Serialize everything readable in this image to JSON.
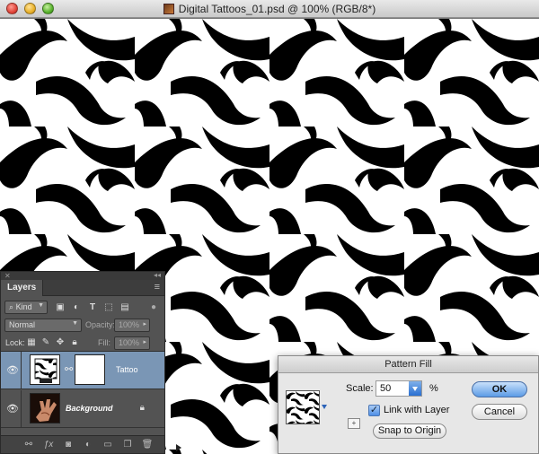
{
  "window": {
    "title": "Digital Tattoos_01.psd @ 100% (RGB/8*)"
  },
  "layers_panel": {
    "tab_label": "Layers",
    "filter_kind": "Kind",
    "blend_mode": "Normal",
    "opacity_label": "Opacity:",
    "opacity_value": "100%",
    "lock_label": "Lock:",
    "fill_label": "Fill:",
    "fill_value": "100%",
    "layers": [
      {
        "name": "Tattoo",
        "selected": true
      },
      {
        "name": "Background",
        "locked": true
      }
    ],
    "accent_color": "#7a96b5"
  },
  "pattern_dialog": {
    "title": "Pattern Fill",
    "scale_label": "Scale:",
    "scale_value": "50",
    "percent_symbol": "%",
    "link_with_layer_label": "Link with Layer",
    "link_with_layer_checked": true,
    "snap_button_label": "Snap to Origin",
    "ok_label": "OK",
    "cancel_label": "Cancel"
  },
  "icons": {
    "eye": "eye-icon",
    "chain": "chain-link-icon",
    "lock": "lock-icon"
  }
}
